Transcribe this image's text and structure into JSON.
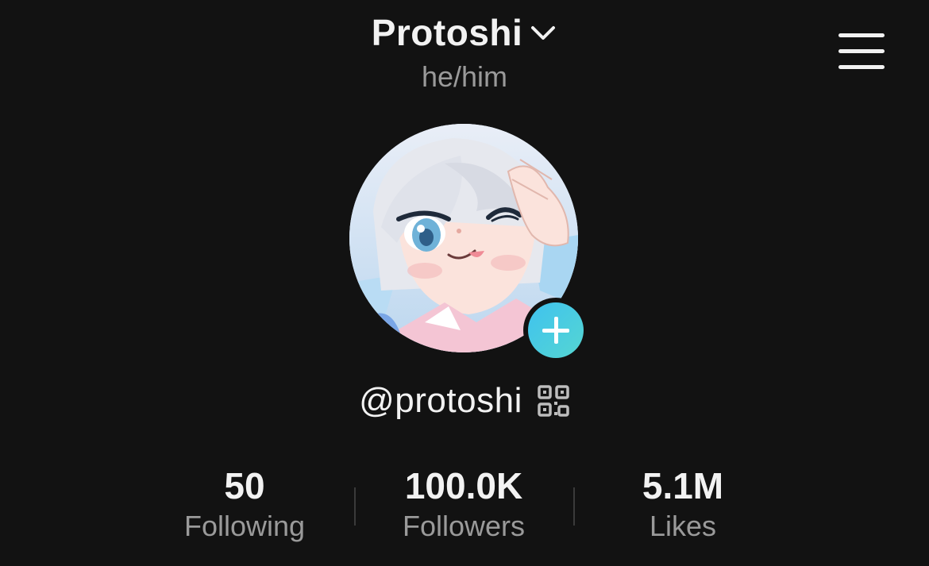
{
  "header": {
    "display_name": "Protoshi",
    "pronouns": "he/him"
  },
  "profile": {
    "handle": "@protoshi"
  },
  "stats": [
    {
      "value": "50",
      "label": "Following"
    },
    {
      "value": "100.0K",
      "label": "Followers"
    },
    {
      "value": "5.1M",
      "label": "Likes"
    }
  ],
  "icons": {
    "dropdown": "chevron-down-icon",
    "menu": "hamburger-menu-icon",
    "add": "plus-icon",
    "qr": "qr-code-icon"
  },
  "colors": {
    "background": "#121212",
    "text_primary": "#f2f2f2",
    "text_secondary": "#9a9a9a",
    "add_button_start": "#3fc2ef",
    "add_button_end": "#55d6d2"
  }
}
